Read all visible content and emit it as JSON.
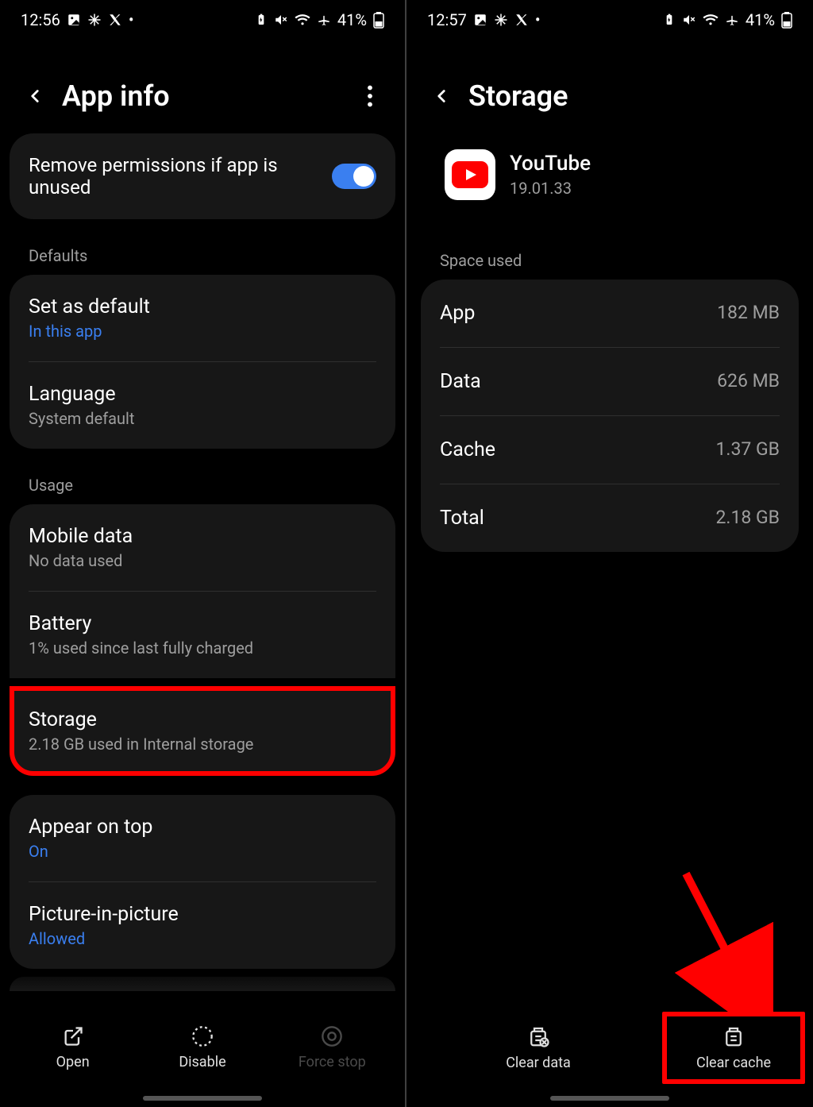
{
  "left": {
    "status": {
      "time": "12:56",
      "battery_text": "41%"
    },
    "header": {
      "title": "App info"
    },
    "toggle_card": {
      "label": "Remove permissions if app is unused",
      "enabled": true
    },
    "sections": {
      "defaults": {
        "label": "Defaults",
        "rows": [
          {
            "title": "Set as default",
            "sub": "In this app",
            "blue": true
          },
          {
            "title": "Language",
            "sub": "System default"
          }
        ]
      },
      "usage": {
        "label": "Usage",
        "rows": [
          {
            "title": "Mobile data",
            "sub": "No data used"
          },
          {
            "title": "Battery",
            "sub": "1% used since last fully charged"
          },
          {
            "title": "Storage",
            "sub": "2.18 GB used in Internal storage",
            "highlight": true
          }
        ]
      },
      "display": {
        "rows": [
          {
            "title": "Appear on top",
            "sub": "On",
            "blue": true
          },
          {
            "title": "Picture-in-picture",
            "sub": "Allowed",
            "blue": true
          }
        ]
      }
    },
    "bottom": {
      "open": "Open",
      "disable": "Disable",
      "force_stop_disabled": "Force stop"
    }
  },
  "right": {
    "status": {
      "time": "12:57",
      "battery_text": "41%"
    },
    "header": {
      "title": "Storage"
    },
    "app": {
      "name": "YouTube",
      "version": "19.01.33"
    },
    "space_used_label": "Space used",
    "rows": {
      "app": {
        "label": "App",
        "value": "182 MB"
      },
      "data": {
        "label": "Data",
        "value": "626 MB"
      },
      "cache": {
        "label": "Cache",
        "value": "1.37 GB"
      },
      "total": {
        "label": "Total",
        "value": "2.18 GB"
      }
    },
    "bottom": {
      "clear_data": "Clear data",
      "clear_cache": "Clear cache"
    }
  }
}
